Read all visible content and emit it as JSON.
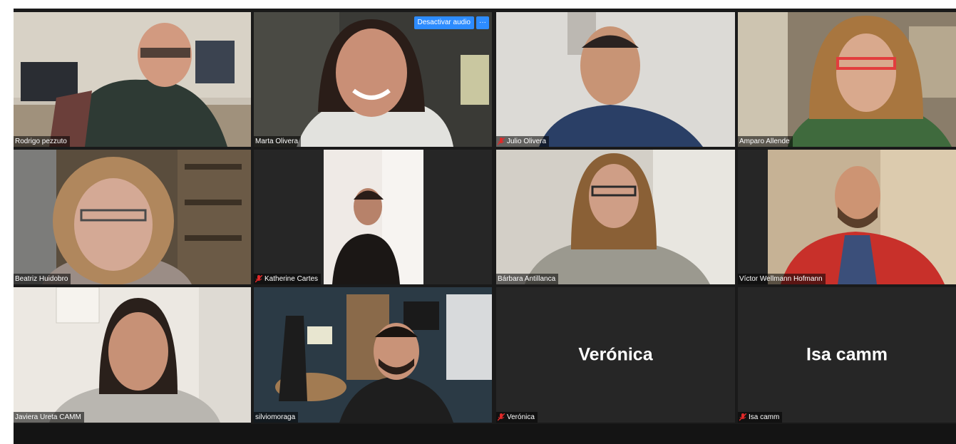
{
  "meeting": {
    "participants": [
      {
        "name": "Rodrigo pezzuto",
        "muted": false
      },
      {
        "name": "Marta Olivera",
        "muted": false
      },
      {
        "name": "Julio Olivera",
        "muted": true
      },
      {
        "name": "Amparo Allende",
        "muted": false
      },
      {
        "name": "Beatriz Huidobro",
        "muted": false
      },
      {
        "name": "Katherine Cartes",
        "muted": true
      },
      {
        "name": "Bárbara Antillanca",
        "muted": false
      },
      {
        "name": "Víctor Wellmann Hofmann",
        "muted": false
      },
      {
        "name": "Javiera Ureta CAMM",
        "muted": false
      },
      {
        "name": "silviomoraga",
        "muted": false,
        "active_speaker": true
      },
      {
        "name": "Verónica",
        "display": "Verónica",
        "muted": true,
        "video_off": true
      },
      {
        "name": "Isa camm",
        "display": "Isa camm",
        "muted": true,
        "video_off": true
      }
    ],
    "hover_controls": {
      "mute_label": "Desactivar audio",
      "more_label": "···"
    }
  },
  "colors": {
    "accent_blue": "#2d8cff",
    "active_border": "#d9e36a",
    "muted_mic": "#e02828"
  }
}
